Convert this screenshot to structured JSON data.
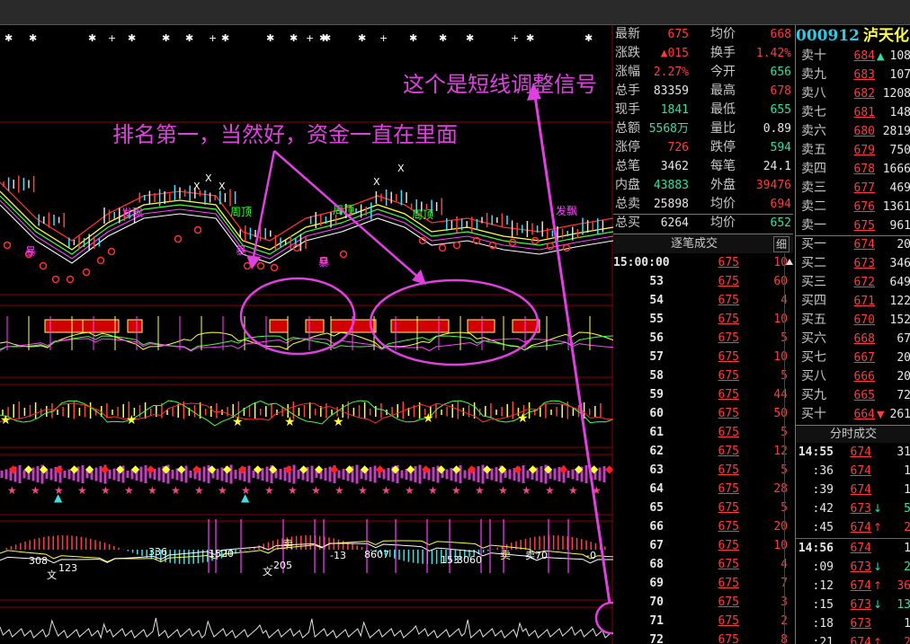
{
  "stock": {
    "code": "000912",
    "name": "泸天化"
  },
  "annotations": {
    "signal": "这个是短线调整信号",
    "rank": "排名第一，当然好，资金一直在里面"
  },
  "quote": [
    {
      "l1": "最新",
      "v1": "675",
      "c1": "red",
      "l2": "均价",
      "v2": "668",
      "c2": "red"
    },
    {
      "l1": "涨跌",
      "v1": "▲015",
      "c1": "red",
      "l2": "换手",
      "v2": "1.42%",
      "c2": "red"
    },
    {
      "l1": "涨幅",
      "v1": "2.27%",
      "c1": "red",
      "l2": "今开",
      "v2": "656",
      "c2": "green"
    },
    {
      "l1": "总手",
      "v1": "83359",
      "c1": "white",
      "l2": "最高",
      "v2": "678",
      "c2": "red"
    },
    {
      "l1": "现手",
      "v1": "1841",
      "c1": "green",
      "l2": "最低",
      "v2": "655",
      "c2": "green"
    },
    {
      "l1": "总额",
      "v1": "5568万",
      "c1": "green",
      "l2": "量比",
      "v2": "0.89",
      "c2": "white"
    },
    {
      "l1": "涨停",
      "v1": "726",
      "c1": "red",
      "l2": "跌停",
      "v2": "594",
      "c2": "green"
    },
    {
      "l1": "总笔",
      "v1": "3462",
      "c1": "white",
      "l2": "每笔",
      "v2": "24.1",
      "c2": "white"
    },
    {
      "l1": "内盘",
      "v1": "43883",
      "c1": "green",
      "l2": "外盘",
      "v2": "39476",
      "c2": "red"
    },
    {
      "l1": "总卖",
      "v1": "25898",
      "c1": "white",
      "l2": "均价",
      "v2": "694",
      "c2": "red"
    },
    {
      "l1": "总买",
      "v1": "6264",
      "c1": "white",
      "l2": "均价",
      "v2": "652",
      "c2": "green"
    }
  ],
  "order_book": [
    {
      "label": "卖十",
      "price": "684",
      "color": "red",
      "arrow": "▲",
      "acolor": "green",
      "vol": "108"
    },
    {
      "label": "卖九",
      "price": "683",
      "color": "red",
      "arrow": "",
      "acolor": "",
      "vol": "107"
    },
    {
      "label": "卖八",
      "price": "682",
      "color": "red",
      "arrow": "",
      "acolor": "",
      "vol": "1208"
    },
    {
      "label": "卖七",
      "price": "681",
      "color": "red",
      "arrow": "",
      "acolor": "",
      "vol": "148"
    },
    {
      "label": "卖六",
      "price": "680",
      "color": "red",
      "arrow": "",
      "acolor": "",
      "vol": "2819"
    },
    {
      "label": "卖五",
      "price": "679",
      "color": "red",
      "arrow": "",
      "acolor": "",
      "vol": "750"
    },
    {
      "label": "卖四",
      "price": "678",
      "color": "red",
      "arrow": "",
      "acolor": "",
      "vol": "1666"
    },
    {
      "label": "卖三",
      "price": "677",
      "color": "red",
      "arrow": "",
      "acolor": "",
      "vol": "469"
    },
    {
      "label": "卖二",
      "price": "676",
      "color": "red",
      "arrow": "",
      "acolor": "",
      "vol": "1361"
    },
    {
      "label": "卖一",
      "price": "675",
      "color": "red",
      "arrow": "",
      "acolor": "",
      "vol": "961"
    },
    {
      "label": "买一",
      "price": "674",
      "color": "red",
      "arrow": "",
      "acolor": "",
      "vol": "20"
    },
    {
      "label": "买二",
      "price": "673",
      "color": "red",
      "arrow": "",
      "acolor": "",
      "vol": "346"
    },
    {
      "label": "买三",
      "price": "672",
      "color": "red",
      "arrow": "",
      "acolor": "",
      "vol": "649"
    },
    {
      "label": "买四",
      "price": "671",
      "color": "red",
      "arrow": "",
      "acolor": "",
      "vol": "122"
    },
    {
      "label": "买五",
      "price": "670",
      "color": "red",
      "arrow": "",
      "acolor": "",
      "vol": "152"
    },
    {
      "label": "买六",
      "price": "668",
      "color": "red",
      "arrow": "",
      "acolor": "",
      "vol": "67"
    },
    {
      "label": "买七",
      "price": "667",
      "color": "red",
      "arrow": "",
      "acolor": "",
      "vol": "20"
    },
    {
      "label": "买八",
      "price": "666",
      "color": "red",
      "arrow": "",
      "acolor": "",
      "vol": "20"
    },
    {
      "label": "买九",
      "price": "665",
      "color": "red",
      "arrow": "",
      "acolor": "",
      "vol": "72"
    },
    {
      "label": "买十",
      "price": "664",
      "color": "red",
      "arrow": "▼",
      "acolor": "red",
      "vol": "261"
    }
  ],
  "ticks": {
    "title": "逐笔成交",
    "button": "细",
    "rows": [
      {
        "t": "15:00:00",
        "p": "675",
        "v": "10"
      },
      {
        "t": "53",
        "p": "675",
        "v": "60"
      },
      {
        "t": "54",
        "p": "675",
        "v": "4"
      },
      {
        "t": "55",
        "p": "675",
        "v": "10"
      },
      {
        "t": "56",
        "p": "675",
        "v": "5"
      },
      {
        "t": "57",
        "p": "675",
        "v": "10"
      },
      {
        "t": "58",
        "p": "675",
        "v": "5"
      },
      {
        "t": "59",
        "p": "675",
        "v": "44"
      },
      {
        "t": "60",
        "p": "675",
        "v": "50"
      },
      {
        "t": "61",
        "p": "675",
        "v": "5"
      },
      {
        "t": "62",
        "p": "675",
        "v": "12"
      },
      {
        "t": "63",
        "p": "675",
        "v": "5"
      },
      {
        "t": "64",
        "p": "675",
        "v": "28"
      },
      {
        "t": "65",
        "p": "675",
        "v": "5"
      },
      {
        "t": "66",
        "p": "675",
        "v": "20"
      },
      {
        "t": "67",
        "p": "675",
        "v": "10"
      },
      {
        "t": "68",
        "p": "675",
        "v": "4"
      },
      {
        "t": "69",
        "p": "675",
        "v": "7"
      },
      {
        "t": "70",
        "p": "675",
        "v": "3"
      },
      {
        "t": "71",
        "p": "675",
        "v": "2"
      },
      {
        "t": "72",
        "p": "675",
        "v": "8"
      }
    ]
  },
  "minute": {
    "title": "分时成交",
    "rows": [
      {
        "t": "14:55",
        "big": true,
        "p": "674",
        "pc": "red",
        "a": "",
        "ac": "",
        "v": "31",
        "vc": "white"
      },
      {
        "t": ":36",
        "big": false,
        "p": "674",
        "pc": "red",
        "a": "",
        "ac": "",
        "v": "1",
        "vc": "white"
      },
      {
        "t": ":39",
        "big": false,
        "p": "674",
        "pc": "red",
        "a": "",
        "ac": "",
        "v": "1",
        "vc": "white"
      },
      {
        "t": ":42",
        "big": false,
        "p": "673",
        "pc": "red",
        "a": "↓",
        "ac": "green",
        "v": "5",
        "vc": "green"
      },
      {
        "t": ":45",
        "big": false,
        "p": "674",
        "pc": "red",
        "a": "↑",
        "ac": "red",
        "v": "2",
        "vc": "red"
      },
      {
        "t": "14:56",
        "big": true,
        "p": "674",
        "pc": "red",
        "a": "",
        "ac": "",
        "v": "1",
        "vc": "white"
      },
      {
        "t": ":09",
        "big": false,
        "p": "673",
        "pc": "red",
        "a": "↓",
        "ac": "green",
        "v": "2",
        "vc": "green"
      },
      {
        "t": ":12",
        "big": false,
        "p": "674",
        "pc": "red",
        "a": "↑",
        "ac": "red",
        "v": "36",
        "vc": "red"
      },
      {
        "t": ":15",
        "big": false,
        "p": "673",
        "pc": "red",
        "a": "↓",
        "ac": "green",
        "v": "13",
        "vc": "green"
      },
      {
        "t": ":18",
        "big": false,
        "p": "673",
        "pc": "red",
        "a": "",
        "ac": "",
        "v": "1",
        "vc": "white"
      },
      {
        "t": ":21",
        "big": false,
        "p": "674",
        "pc": "red",
        "a": "↑",
        "ac": "red",
        "v": "2",
        "vc": "red"
      }
    ]
  },
  "chart_labels": {
    "fa_piao_1": "发飘",
    "fa_piao_2": "发飘",
    "zhou_ding_1": "周顶",
    "zhou_ding_2": "周顶",
    "zhou_ding_3": "周顶",
    "bao_1": "暴",
    "bao_2": "暴",
    "bao_3": "暴",
    "mai_1": "卖",
    "mai_2": "卖",
    "num_336": "336",
    "num_205": "-205",
    "num_13": "-13",
    "num_0": "-0",
    "num_1520": "1520",
    "num_123": "123",
    "num_308": "308",
    "num_3060": "3060",
    "num_1530": "153",
    "num_8607": "8607",
    "mai_70": "卖70",
    "wen_1": "文",
    "wen_2": "文"
  },
  "colors": {
    "up": "#ff3b3b",
    "down": "#34e0a1",
    "annotation": "#e040e0",
    "grid": "#8b0000"
  }
}
